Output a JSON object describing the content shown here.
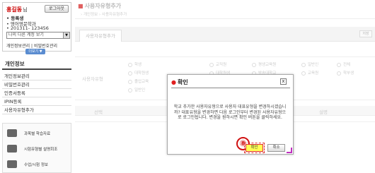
{
  "profile": {
    "name": "홍길동",
    "honorific": "님",
    "logout": "로그아웃",
    "role": "• 등록생",
    "dept": "• 영어영문학과",
    "id": "• 201311- 123456",
    "account_select": "나의 다른 계정 보기",
    "links": "개인정보관리 | 비밀번호관리",
    "more": "더보기 ▼"
  },
  "menu": {
    "title": "개인정보",
    "items": [
      "개인정보관리",
      "비밀번호관리",
      "인증서등록",
      "IPIN등록",
      "사용자유형추가"
    ]
  },
  "banners": [
    "과목별 학습자료",
    "시험유형별 설명회조",
    "수업/시험 정보"
  ],
  "main": {
    "title": "사용자유형추가",
    "breadcrumb": "› 개인정보 › 사용자유형추가",
    "tab": "사용자유형추가",
    "tab_button": "저장",
    "grid_label": "사용자유형",
    "grid_cells": [
      "학생",
      "대학원생",
      "졸업교육",
      "일반인",
      "교직원",
      "대학원생",
      "평생교육원",
      "방송대학교",
      "일반인",
      "교육원",
      "전체",
      "학부생"
    ],
    "table_headers": [
      "선택",
      "유형",
      "설명"
    ]
  },
  "dialog": {
    "title": "확인",
    "close": "x",
    "message": "학교 추가한 사용자유형으로 사용자 대표유형을 변경하시겠습니까? 대표유형을 변경하면 다음 로그인부터 변경된 사용자유형으로 로그인됩니다. 변경을 원하시면 확인 버튼을 클릭하세요.",
    "step_marker": "⑧",
    "ok": "확인",
    "cancel": "취소"
  },
  "colors": {
    "accent": "#d01010",
    "highlight": "#ffff55",
    "link_blue": "#5a8cd0"
  }
}
